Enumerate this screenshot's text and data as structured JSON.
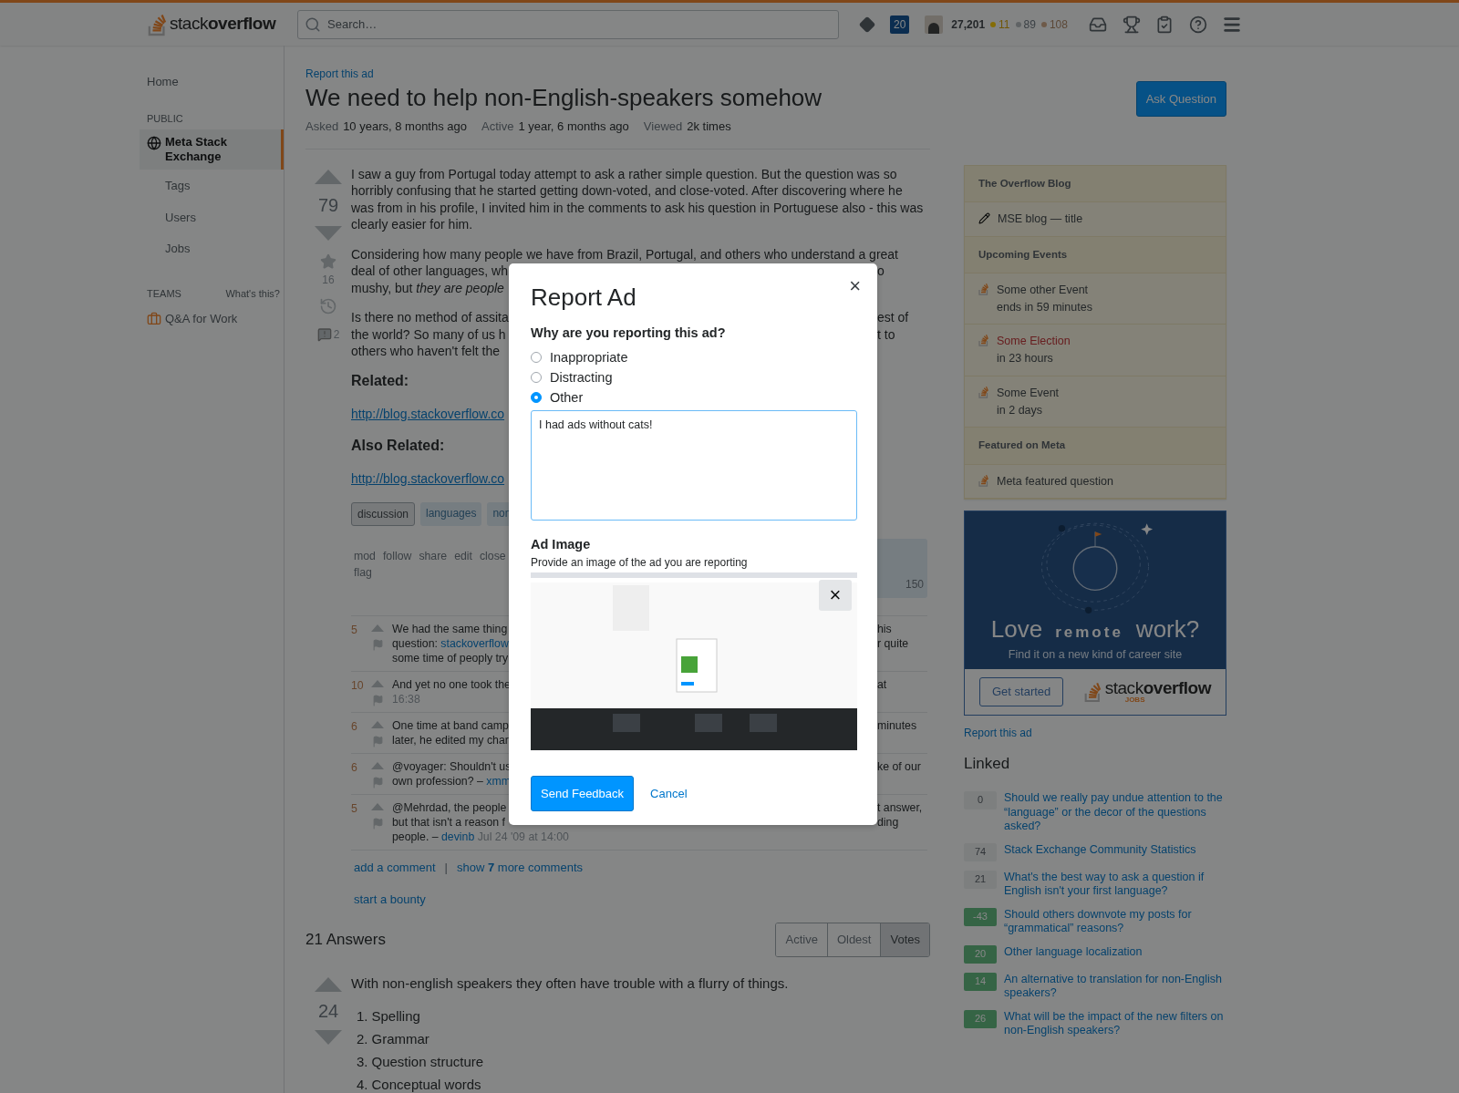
{
  "topbar": {
    "logo_light": "stack",
    "logo_bold": "overflow",
    "search_placeholder": "Search…",
    "review_count": "20",
    "reputation": "27,201",
    "badges": [
      {
        "kind": "gold",
        "count": "11"
      },
      {
        "kind": "silver",
        "count": "89"
      },
      {
        "kind": "bronze",
        "count": "108"
      }
    ]
  },
  "sidebar": {
    "items": [
      {
        "kind": "link",
        "label": "Home",
        "selected": false
      },
      {
        "kind": "heading",
        "label": "PUBLIC"
      },
      {
        "kind": "site",
        "label": "Meta Stack Exchange",
        "selected": true
      },
      {
        "kind": "sub",
        "label": "Tags",
        "selected": false
      },
      {
        "kind": "sub",
        "label": "Users",
        "selected": false
      },
      {
        "kind": "sub",
        "label": "Jobs",
        "selected": false
      }
    ],
    "teams": {
      "label": "TEAMS",
      "help": "What's this?",
      "item": "Q&A for Work"
    }
  },
  "question": {
    "report_ad": "Report this ad",
    "title": "We need to help non-English-speakers somehow",
    "ask_button": "Ask Question",
    "meta": [
      {
        "label": "Asked",
        "value": "10 years, 8 months ago"
      },
      {
        "label": "Active",
        "value": "1 year, 6 months ago"
      },
      {
        "label": "Viewed",
        "value": "2k times"
      }
    ],
    "score": "79",
    "favorites": "16",
    "flags": "2",
    "body": [
      {
        "kind": "paragraph",
        "text": "I saw a guy from Portugal today attempt to ask a rather simple question. But the question was so horribly confusing that he started getting down-voted, and close-voted. After discovering where he was from in his profile, I invited him in the comments to ask his question in Portuguese also - this was clearly easier for him."
      },
      {
        "kind": "covered",
        "lines": [
          {
            "text": "Considering how many people we have from Brazil, Portugal, and others who understand a great"
          },
          {
            "text": "deal of other languages, wh",
            "right": "o"
          },
          {
            "text": "mushy, but *they are people*"
          }
        ]
      },
      {
        "kind": "covered",
        "lines": [
          {
            "text": "Is there no method of assita",
            "right": "est of"
          },
          {
            "text": "the world? So many of us h",
            "right": "t to"
          },
          {
            "text": "others who haven't felt the"
          }
        ]
      },
      {
        "kind": "heading",
        "text": "Related:"
      },
      {
        "kind": "link",
        "text": "http://blog.stackoverflow.co"
      },
      {
        "kind": "heading",
        "text": "Also Related:"
      },
      {
        "kind": "link",
        "text": "http://blog.stackoverflow.co"
      }
    ],
    "tags": [
      {
        "label": "discussion",
        "kind": "required"
      },
      {
        "label": "languages",
        "kind": "normal"
      },
      {
        "label": "non",
        "kind": "normal"
      }
    ],
    "post_menu": [
      [
        "mod",
        "follow",
        "share",
        "edit",
        "close"
      ],
      [
        "flag"
      ]
    ],
    "user_card": "150",
    "comments": [
      {
        "score": "5",
        "lines": [
          {
            "text": "We had the same thing",
            "right": "his"
          },
          {
            "text": "question: ",
            "link": "stackoverflow",
            "right": "r quite"
          },
          {
            "text": "some time of peoply try"
          }
        ]
      },
      {
        "score": "10",
        "lines": [
          {
            "text": "And yet no one took the",
            "right": "at"
          },
          {
            "date": "16:38"
          }
        ]
      },
      {
        "score": "6",
        "lines": [
          {
            "text": "One time at band camp",
            "right": "minutes"
          },
          {
            "text": "later, he edited my char"
          }
        ]
      },
      {
        "score": "6",
        "lines": [
          {
            "text": "@voyager: Shouldn't us",
            "right": "ke of our"
          },
          {
            "text": "own profession? –",
            "link": "xmm"
          }
        ]
      },
      {
        "score": "5",
        "lines": [
          {
            "text": "@Mehrdad, the people",
            "right": "t answer,"
          },
          {
            "text": "but that isn't a reason f",
            "right": "ding"
          },
          {
            "text": "people. –",
            "link": "devinb",
            "date": "Jul 24 '09 at 14:00"
          }
        ]
      }
    ],
    "comment_actions": {
      "add": "add a comment",
      "separator": "|",
      "more": "show **7** more comments"
    },
    "bounty": "start a bounty"
  },
  "answers": {
    "count_label": "21 Answers",
    "sort_tabs": [
      {
        "label": "Active",
        "selected": false
      },
      {
        "label": "Oldest",
        "selected": false
      },
      {
        "label": "Votes",
        "selected": true
      }
    ],
    "first": {
      "score": "24",
      "intro": "With non-english speakers they often have trouble with a flurry of things.",
      "items": [
        {
          "number": "1.",
          "text": "Spelling"
        },
        {
          "number": "2.",
          "text": "Grammar"
        },
        {
          "number": "3.",
          "text": "Question structure"
        },
        {
          "number": "4.",
          "text": "Conceptual words"
        }
      ]
    }
  },
  "right_sidebar": {
    "widget": [
      {
        "title": "The Overflow Blog",
        "items": [
          {
            "kind": "pencil",
            "text": "MSE blog — title",
            "urgent": false
          }
        ]
      },
      {
        "title": "Upcoming Events",
        "items": [
          {
            "kind": "site",
            "text": "Some other Event",
            "sub": "ends in 59 minutes",
            "urgent": false
          },
          {
            "kind": "site",
            "text": "Some Election",
            "sub": "in 23 hours",
            "urgent": true
          },
          {
            "kind": "site",
            "text": "Some Event",
            "sub": "in 2 days",
            "urgent": false
          }
        ]
      },
      {
        "title": "Featured on Meta",
        "items": [
          {
            "kind": "site",
            "text": "Meta featured question",
            "urgent": false
          }
        ]
      }
    ],
    "ad": {
      "love": "Love",
      "remote": "remote",
      "work": "work?",
      "tagline": "Find it on a new kind of career site",
      "button": "Get started",
      "logo_light": "stack",
      "logo_bold": "overflow",
      "logo_sub": "JOBS"
    },
    "report_ad": "Report this ad",
    "linked_title": "Linked",
    "linked": [
      {
        "score": "0",
        "accepted": false,
        "title": "Should we really pay undue attention to the “language” or the decor of the questions asked?"
      },
      {
        "score": "74",
        "accepted": false,
        "title": "Stack Exchange Community Statistics"
      },
      {
        "score": "21",
        "accepted": false,
        "title": "What's the best way to ask a question if English isn't your first language?"
      },
      {
        "score": "-43",
        "accepted": true,
        "title": "Should others downvote my posts for “grammatical” reasons?"
      },
      {
        "score": "20",
        "accepted": true,
        "title": "Other language localization"
      },
      {
        "score": "14",
        "accepted": true,
        "title": "An alternative to translation for non-English speakers?"
      },
      {
        "score": "26",
        "accepted": true,
        "title": "What will be the impact of the new filters on non-English speakers?"
      }
    ]
  },
  "modal": {
    "title": "Report Ad",
    "close": "×",
    "question": "Why are you reporting this ad?",
    "options": [
      {
        "label": "Inappropriate",
        "selected": false
      },
      {
        "label": "Distracting",
        "selected": false
      },
      {
        "label": "Other",
        "selected": true
      }
    ],
    "details": "I had ads without cats!",
    "image_heading": "Ad Image",
    "image_hint": "Provide an image of the ad you are reporting",
    "remove": "×",
    "submit": "Send Feedback",
    "cancel": "Cancel"
  }
}
